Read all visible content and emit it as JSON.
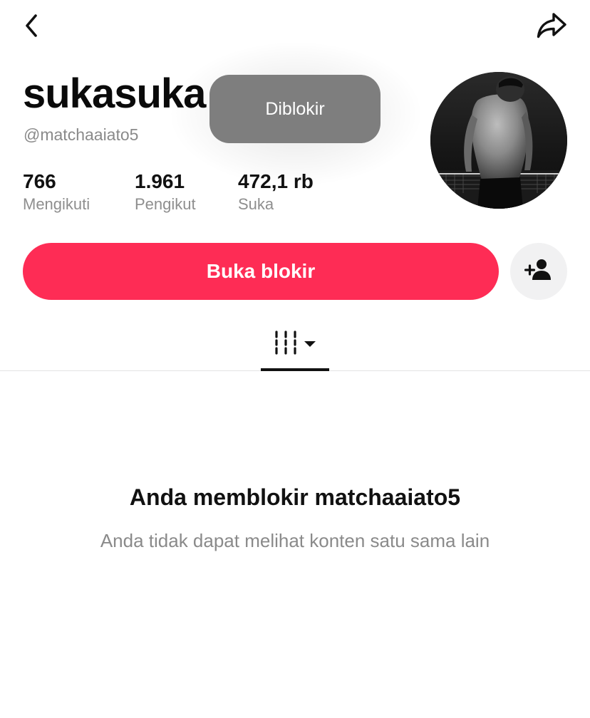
{
  "profile": {
    "display_name": "sukasuka",
    "username": "@matchaaiato5"
  },
  "stats": [
    {
      "value": "766",
      "label": "Mengikuti"
    },
    {
      "value": "1.961",
      "label": "Pengikut"
    },
    {
      "value": "472,1 rb",
      "label": "Suka"
    }
  ],
  "toast": {
    "text": "Diblokir"
  },
  "actions": {
    "unblock_label": "Buka blokir",
    "unblock_color": "#fe2c55"
  },
  "icons": {
    "back": "chevron-left-icon",
    "share": "share-arrow-icon",
    "add_friend": "person-add-icon",
    "videos_tab": "grid-icon",
    "dropdown": "caret-down-icon"
  },
  "empty_state": {
    "title": "Anda memblokir matchaaiato5",
    "subtitle": "Anda tidak dapat melihat konten satu sama lain"
  }
}
